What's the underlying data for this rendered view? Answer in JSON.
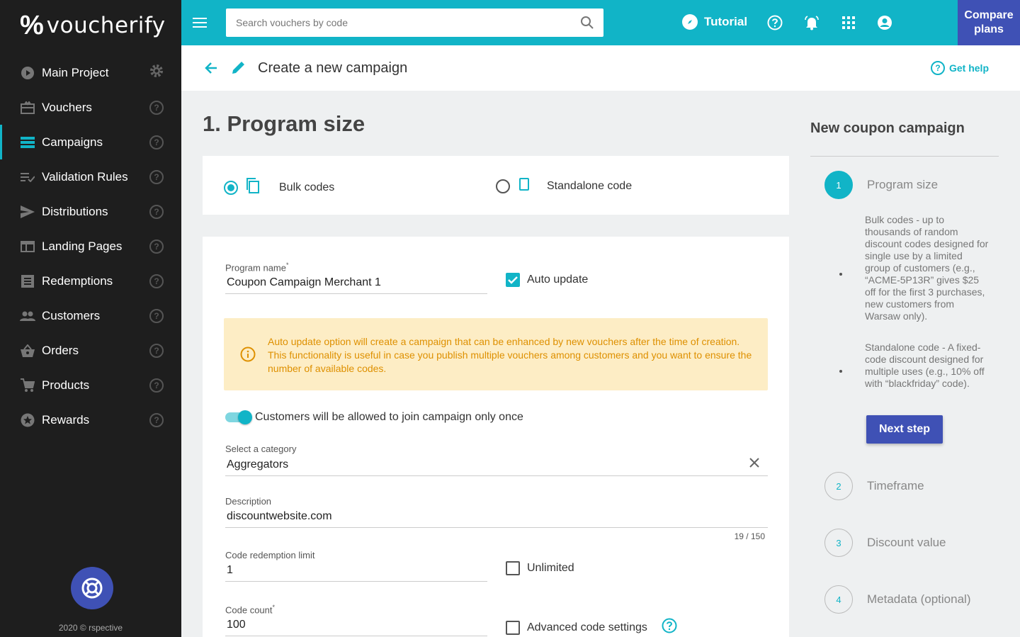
{
  "brand": {
    "logo_mark": "%",
    "logo_text": "voucherify"
  },
  "sidebar": {
    "items": [
      {
        "label": "Main Project",
        "icon": "play-circle-icon",
        "active": false,
        "trailing": "gear"
      },
      {
        "label": "Vouchers",
        "icon": "voucher-icon",
        "active": false,
        "trailing": "help"
      },
      {
        "label": "Campaigns",
        "icon": "campaigns-list-icon",
        "active": true,
        "trailing": "help"
      },
      {
        "label": "Validation Rules",
        "icon": "rules-icon",
        "active": false,
        "trailing": "help"
      },
      {
        "label": "Distributions",
        "icon": "send-icon",
        "active": false,
        "trailing": "help"
      },
      {
        "label": "Landing Pages",
        "icon": "web-page-icon",
        "active": false,
        "trailing": "help"
      },
      {
        "label": "Redemptions",
        "icon": "receipt-icon",
        "active": false,
        "trailing": "help"
      },
      {
        "label": "Customers",
        "icon": "people-icon",
        "active": false,
        "trailing": "help"
      },
      {
        "label": "Orders",
        "icon": "basket-icon",
        "active": false,
        "trailing": "help"
      },
      {
        "label": "Products",
        "icon": "cart-icon",
        "active": false,
        "trailing": "help"
      },
      {
        "label": "Rewards",
        "icon": "star-badge-icon",
        "active": false,
        "trailing": "help"
      }
    ],
    "help_glyph": "?",
    "footer": "2020 © rspective"
  },
  "topbar": {
    "search_placeholder": "Search vouchers by code",
    "tutorial_label": "Tutorial",
    "compare_label_1": "Compare",
    "compare_label_2": "plans",
    "accent": "#11b4c7",
    "primary": "#3f51b5"
  },
  "header": {
    "title": "Create a new campaign",
    "get_help": "Get help",
    "help_glyph": "?"
  },
  "main": {
    "section_title": "1. Program size",
    "types": [
      {
        "label": "Bulk codes",
        "selected": true
      },
      {
        "label": "Standalone code",
        "selected": false
      }
    ],
    "program_name_label": "Program name",
    "program_name_required": "*",
    "program_name_value": "Coupon Campaign Merchant 1",
    "auto_update_label": "Auto update",
    "auto_update_checked": true,
    "alert_text": "Auto update option will create a campaign that can be enhanced by new vouchers after the time of creation. This functionality is useful in case you publish multiple vouchers among customers and you want to ensure the number of available codes.",
    "join_once_label": "Customers will be allowed to join campaign only once",
    "join_once_on": true,
    "category_label": "Select a category",
    "category_value": "Aggregators",
    "description_label": "Description",
    "description_value": "discountwebsite.com",
    "description_counter": "19 / 150",
    "redemption_label": "Code redemption limit",
    "redemption_value": "1",
    "unlimited_label": "Unlimited",
    "code_count_label": "Code count",
    "code_count_required": "*",
    "code_count_value": "100",
    "advanced_label": "Advanced code settings"
  },
  "right_panel": {
    "title": "New coupon campaign",
    "steps": [
      {
        "num": "1",
        "label": "Program size",
        "active": true
      },
      {
        "num": "2",
        "label": "Timeframe",
        "active": false
      },
      {
        "num": "3",
        "label": "Discount value",
        "active": false
      },
      {
        "num": "4",
        "label": "Metadata (optional)",
        "active": false
      }
    ],
    "bulk_desc": "Bulk codes - up to thousands of random discount codes designed for single use by a limited group of customers (e.g., “ACME-5P13R” gives $25 off for the first 3 purchases, new customers from Warsaw only).",
    "standalone_desc": "Standalone code - A fixed-code discount designed for multiple uses (e.g., 10% off with “blackfriday” code).",
    "next_button": "Next step"
  }
}
